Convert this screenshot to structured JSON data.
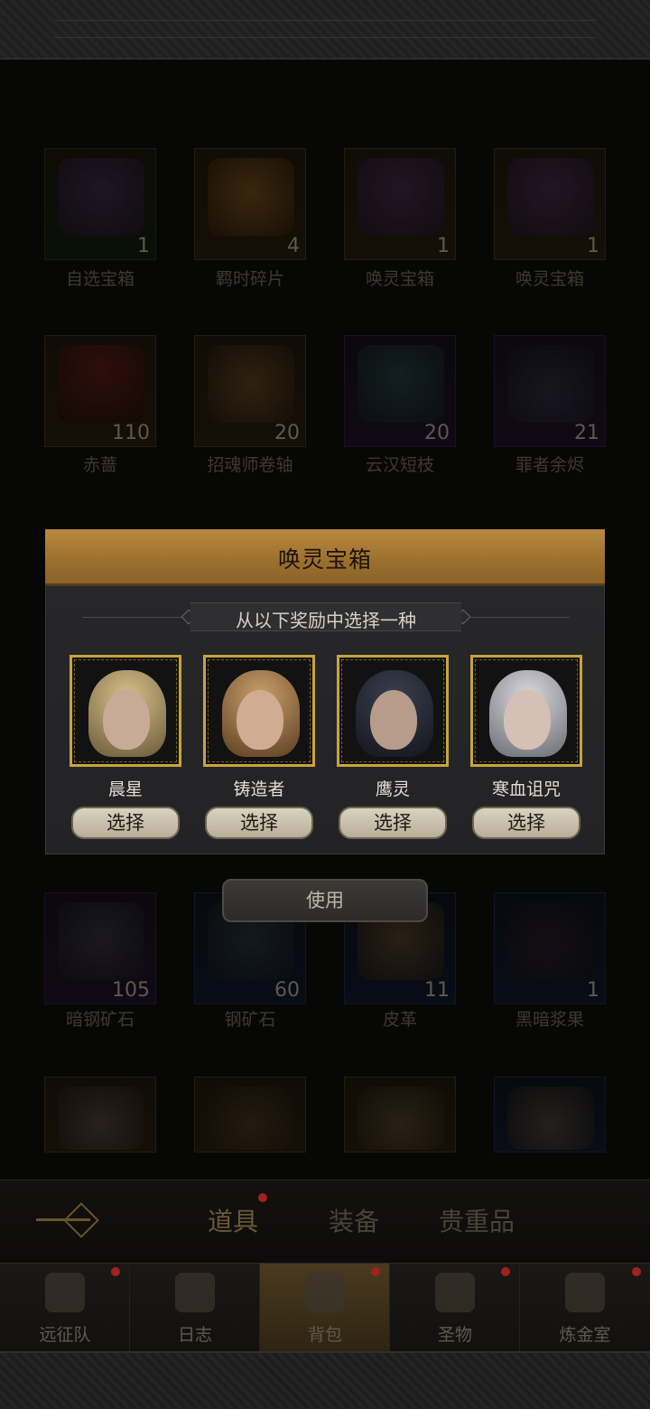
{
  "inventory": {
    "items": [
      {
        "name": "自选宝箱",
        "count": "1"
      },
      {
        "name": "羁时碎片",
        "count": "4"
      },
      {
        "name": "唤灵宝箱",
        "count": "1"
      },
      {
        "name": "唤灵宝箱",
        "count": "1"
      },
      {
        "name": "赤蔷",
        "count": "110"
      },
      {
        "name": "招魂师卷轴",
        "count": "20"
      },
      {
        "name": "云汉短枝",
        "count": "20"
      },
      {
        "name": "罪者余烬",
        "count": "21"
      },
      {
        "name": "暗钢矿石",
        "count": "105"
      },
      {
        "name": "钢矿石",
        "count": "60"
      },
      {
        "name": "皮革",
        "count": "11"
      },
      {
        "name": "黑暗浆果",
        "count": "1"
      }
    ]
  },
  "popup": {
    "title": "唤灵宝箱",
    "subtitle": "从以下奖励中选择一种",
    "choices": [
      {
        "name": "晨星",
        "button": "选择"
      },
      {
        "name": "铸造者",
        "button": "选择"
      },
      {
        "name": "鹰灵",
        "button": "选择"
      },
      {
        "name": "寒血诅咒",
        "button": "选择"
      }
    ],
    "use_button": "使用"
  },
  "tabs": [
    "道具",
    "装备",
    "贵重品"
  ],
  "nav": [
    "远征队",
    "日志",
    "背包",
    "圣物",
    "炼金室"
  ],
  "colors": {
    "header_gold": "#b9893e",
    "portrait_border": "#c8a43a",
    "notification_red": "#a1211c"
  }
}
